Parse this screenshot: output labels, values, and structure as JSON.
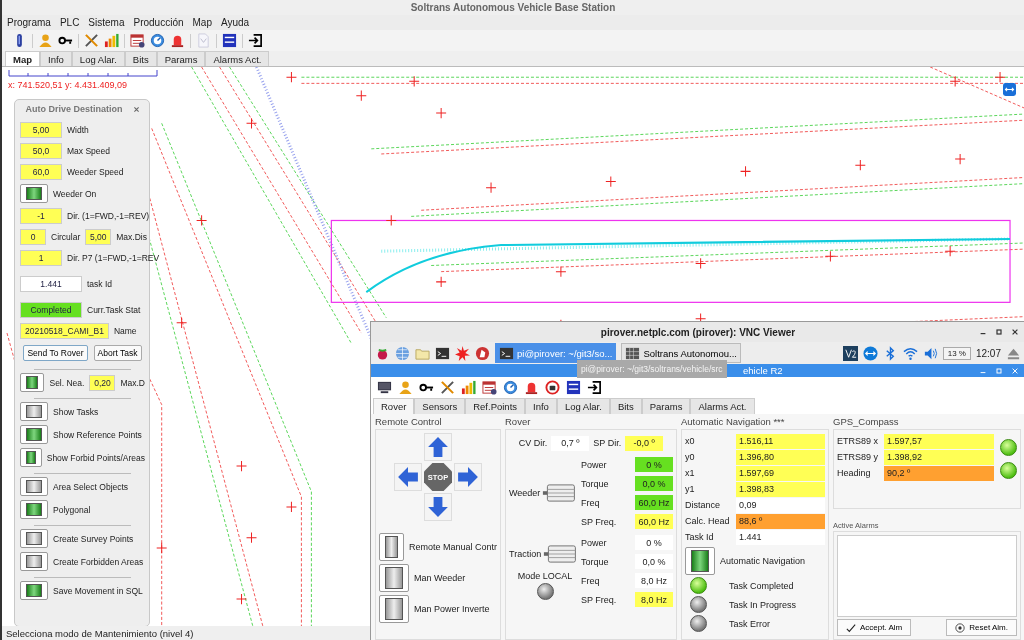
{
  "window": {
    "title": "Soltrans Autonomous Vehicle Base Station"
  },
  "menu": [
    "Programa",
    "PLC",
    "Sistema",
    "Producción",
    "Map",
    "Ayuda"
  ],
  "tabs": [
    {
      "label": "Map",
      "selected": true
    },
    {
      "label": "Info",
      "selected": false
    },
    {
      "label": "Log Alar.",
      "selected": false
    },
    {
      "label": "Bits",
      "selected": false
    },
    {
      "label": "Params",
      "selected": false
    },
    {
      "label": "Alarms Act.",
      "selected": false
    }
  ],
  "map": {
    "coordinates": "x: 741.520,51 y: 4.431.409,09"
  },
  "auto_drive": {
    "title": "Auto Drive Destination",
    "groups": [
      [
        {
          "kind": "input",
          "value": "5,00",
          "label": "Width"
        },
        {
          "kind": "input",
          "value": "50,0",
          "label": "Max Speed"
        },
        {
          "kind": "input",
          "value": "60,0",
          "label": "Weeder Speed"
        },
        {
          "kind": "toggle",
          "label": "Weeder On",
          "on": true
        },
        {
          "kind": "input",
          "value": "-1",
          "label": "Dir. (1=FWD,-1=REV)"
        },
        {
          "kind": "pair",
          "value": "0",
          "label": "Circular",
          "value_2": "5,00",
          "label_2": "Max.Dis"
        },
        {
          "kind": "input",
          "value": "1",
          "label": "Dir. P7 (1=FWD,-1=REV"
        },
        {
          "kind": "readout",
          "value": "1.441",
          "label": "task Id"
        },
        {
          "kind": "status",
          "value": "Completed",
          "label": "Curr.Task Stat"
        },
        {
          "kind": "input",
          "value": "20210518_CAMI_B1",
          "label": "Name"
        },
        {
          "kind": "buttons",
          "labels": [
            "Send To Rover",
            "Abort Task"
          ]
        }
      ],
      [
        {
          "kind": "toggle_field",
          "label": "Sel. Nea.",
          "on": true,
          "value": "0,20",
          "label_2": "Max.D"
        }
      ],
      [
        {
          "kind": "toggle",
          "label": "Show Tasks",
          "on": false
        },
        {
          "kind": "toggle",
          "label": "Show Reference Points",
          "on": true
        },
        {
          "kind": "toggle",
          "label": "Show Forbid Points/Areas",
          "on": true
        }
      ],
      [
        {
          "kind": "toggle",
          "label": "Area Select Objects",
          "on": false
        },
        {
          "kind": "toggle",
          "label": "Polygonal",
          "on": true
        }
      ],
      [
        {
          "kind": "toggle",
          "label": "Create Survey Points",
          "on": false
        },
        {
          "kind": "toggle",
          "label": "Create Forbidden Areas",
          "on": false
        }
      ],
      [
        {
          "kind": "toggle",
          "label": "Save Movement in SQL",
          "on": true
        }
      ]
    ]
  },
  "status_bar": "Selecciona modo de Mantenimiento (nivel 4)",
  "vnc": {
    "title": "pirover.netplc.com (pirover): VNC Viewer",
    "taskbar": [
      {
        "label": "pi@pirover: ~/git3/so...",
        "selected": true
      },
      {
        "label": "Soltrans Autonomou...",
        "selected": false
      }
    ],
    "cpu": "13 %",
    "clock": "12:07",
    "tooltip": "pi@pirover: ~/git3/soltrans/vehicle/src",
    "app_title": "ehicle R2",
    "tabs": [
      {
        "label": "Rover",
        "selected": true
      },
      {
        "label": "Sensors",
        "selected": false
      },
      {
        "label": "Ref.Points",
        "selected": false
      },
      {
        "label": "Info",
        "selected": false
      },
      {
        "label": "Log Alar.",
        "selected": false
      },
      {
        "label": "Bits",
        "selected": false
      },
      {
        "label": "Params",
        "selected": false
      },
      {
        "label": "Alarms Act.",
        "selected": false
      }
    ],
    "remote_control": {
      "title": "Remote Control",
      "stop": "STOP",
      "toggles": [
        {
          "label": "Remote Manual Contr",
          "on": false
        },
        {
          "label": "Man Weeder",
          "on": false
        },
        {
          "label": "Man Power Inverte",
          "on": false
        }
      ]
    },
    "rover": {
      "title": "Rover",
      "cv_label": "CV Dir.",
      "cv_value": "0,7 º",
      "sp_label": "SP Dir.",
      "sp_value": "-0,0 º",
      "motors": [
        {
          "name": "Weeder",
          "rows": [
            {
              "label": "Power",
              "value": "0 %",
              "kind": "status"
            },
            {
              "label": "Torque",
              "value": "0,0 %",
              "kind": "status"
            },
            {
              "label": "Freq",
              "value": "60,0 Hz",
              "kind": "status"
            },
            {
              "label": "SP Freq.",
              "value": "60,0 Hz",
              "kind": "input"
            }
          ]
        },
        {
          "name": "Traction",
          "rows": [
            {
              "label": "Power",
              "value": "0 %",
              "kind": "readout"
            },
            {
              "label": "Torque",
              "value": "0,0 %",
              "kind": "readout"
            },
            {
              "label": "Freq",
              "value": "8,0 Hz",
              "kind": "readout"
            },
            {
              "label": "SP Freq.",
              "value": "8,0 Hz",
              "kind": "input"
            }
          ]
        }
      ],
      "mode": {
        "label": "Mode LOCAL",
        "on": false
      }
    },
    "auto_nav": {
      "title": "Automatic Navigation ***",
      "rows": [
        {
          "label": "x0",
          "value": "1.516,11",
          "kind": "input"
        },
        {
          "label": "y0",
          "value": "1.396,80",
          "kind": "input"
        },
        {
          "label": "x1",
          "value": "1.597,69",
          "kind": "input"
        },
        {
          "label": "y1",
          "value": "1.398,83",
          "kind": "input"
        },
        {
          "label": "Distance",
          "value": "0,09",
          "kind": "readout"
        },
        {
          "label": "Calc. Head",
          "value": "88,6 º",
          "kind": "warning"
        },
        {
          "label": "Task Id",
          "value": "1.441",
          "kind": "readout"
        }
      ],
      "toggle": {
        "label": "Automatic Navigation",
        "on": true
      },
      "lamps": [
        {
          "label": "Task Completed",
          "on": true
        },
        {
          "label": "Task In Progress",
          "on": false
        },
        {
          "label": "Task Error",
          "on": false
        }
      ]
    },
    "gps": {
      "title": "GPS_Compass",
      "rows": [
        {
          "label": "ETRS89 x",
          "value": "1.597,57",
          "kind": "input"
        },
        {
          "label": "ETRS89 y",
          "value": "1.398,92",
          "kind": "input"
        },
        {
          "label": "Heading",
          "value": "90,2 º",
          "kind": "warning"
        }
      ],
      "lamps": [
        {
          "on": true
        },
        {
          "on": true
        }
      ]
    },
    "alarms": {
      "title": "Active Alarms",
      "accept": "Accept. Alm",
      "reset": "Reset Alm."
    }
  }
}
